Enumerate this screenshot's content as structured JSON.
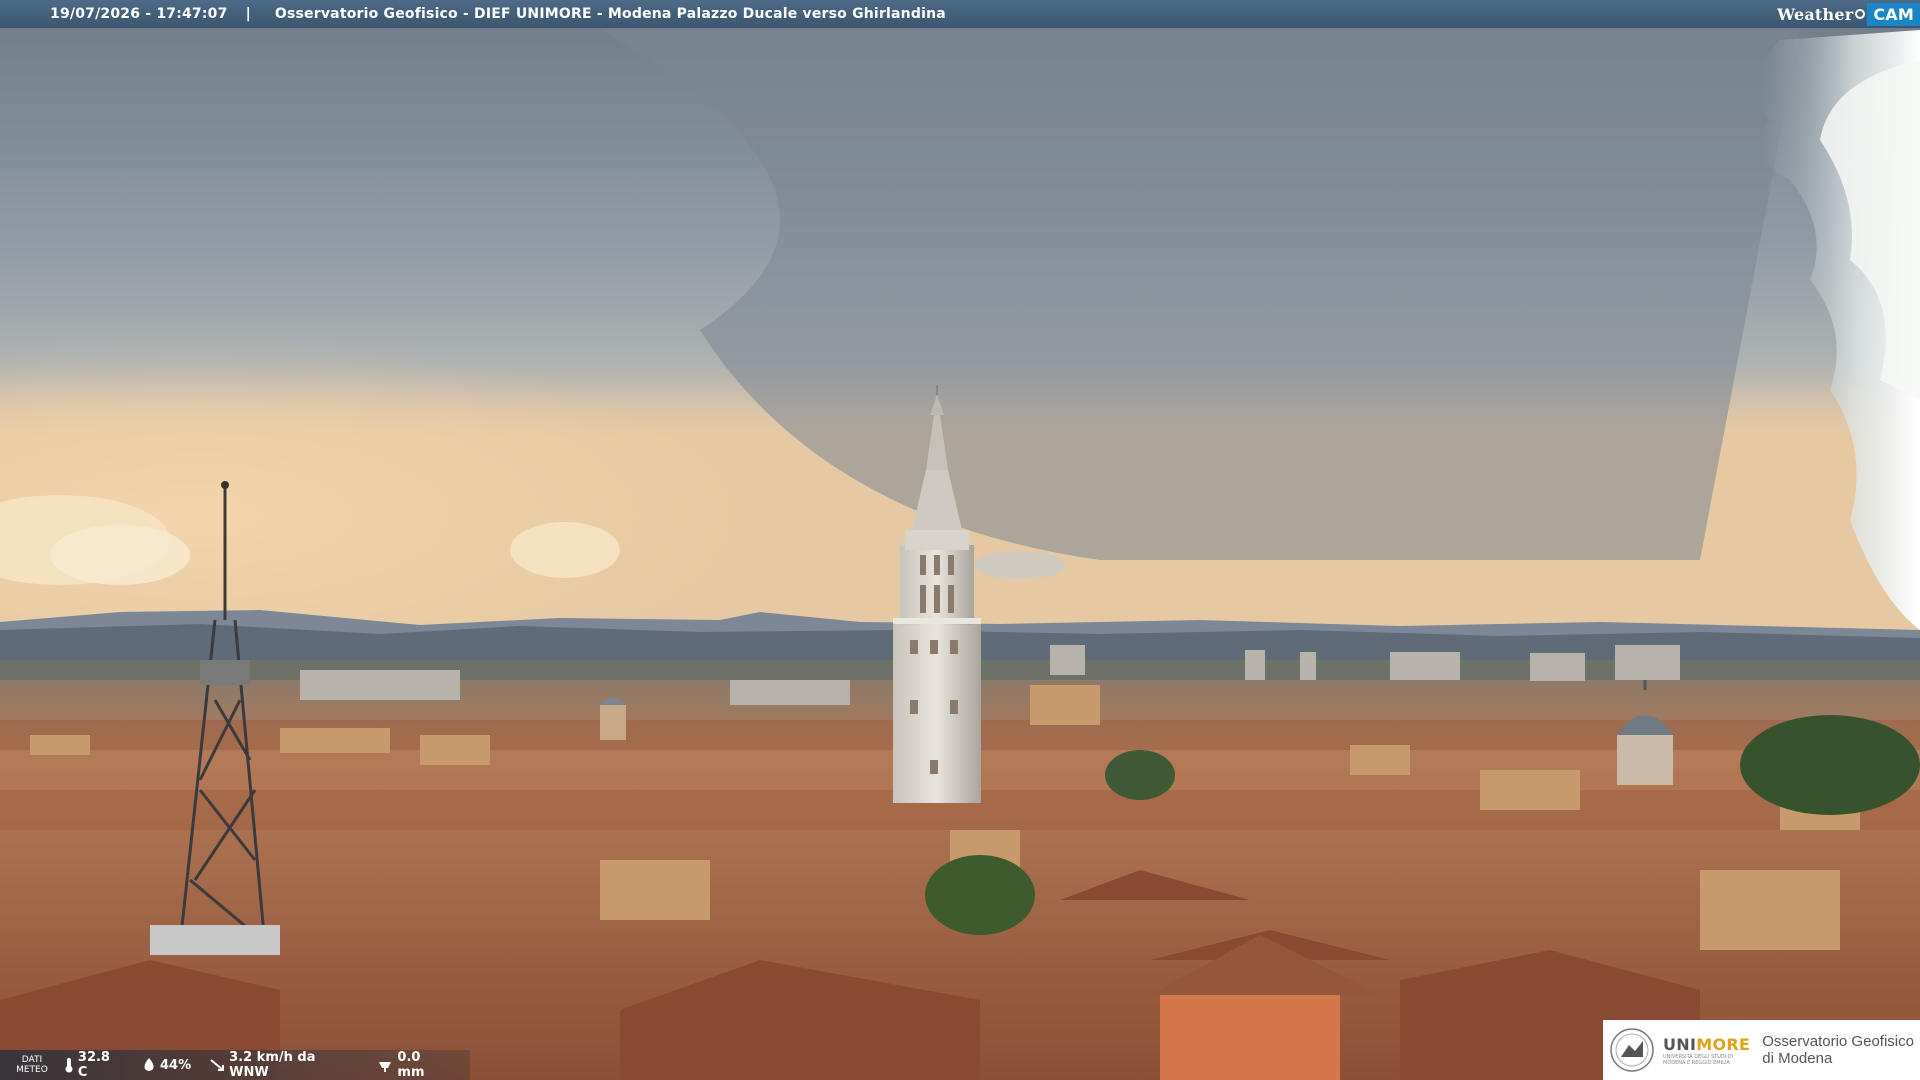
{
  "caption": {
    "timestamp": "19/07/2026 - 17:47:07",
    "separator": "|",
    "location": "Osservatorio Geofisico - DIEF UNIMORE - Modena Palazzo Ducale verso Ghirlandina"
  },
  "brand": {
    "weather": "Weather",
    "cam": "CAM"
  },
  "meteo": {
    "label_line1": "DATI",
    "label_line2": "METEO",
    "temperature": "32.8 C",
    "humidity": "44%",
    "wind": "3.2 km/h da WNW",
    "rain": "0.0 mm"
  },
  "logo": {
    "name_a": "UNI",
    "name_b": "MORE",
    "sub1": "UNIVERSITÀ DEGLI STUDI DI",
    "sub2": "MODENA E REGGIO EMILIA",
    "obs_line1": "Osservatorio Geofisico",
    "obs_line2": "di Modena"
  },
  "colors": {
    "sky_top": "#7f8a96",
    "sky_glow": "#e8c9a0",
    "roofs": "#a86a4a",
    "tower": "#d9d6d0",
    "brand_blue": "#1a86c8",
    "unimore_orange": "#e3a11a"
  }
}
